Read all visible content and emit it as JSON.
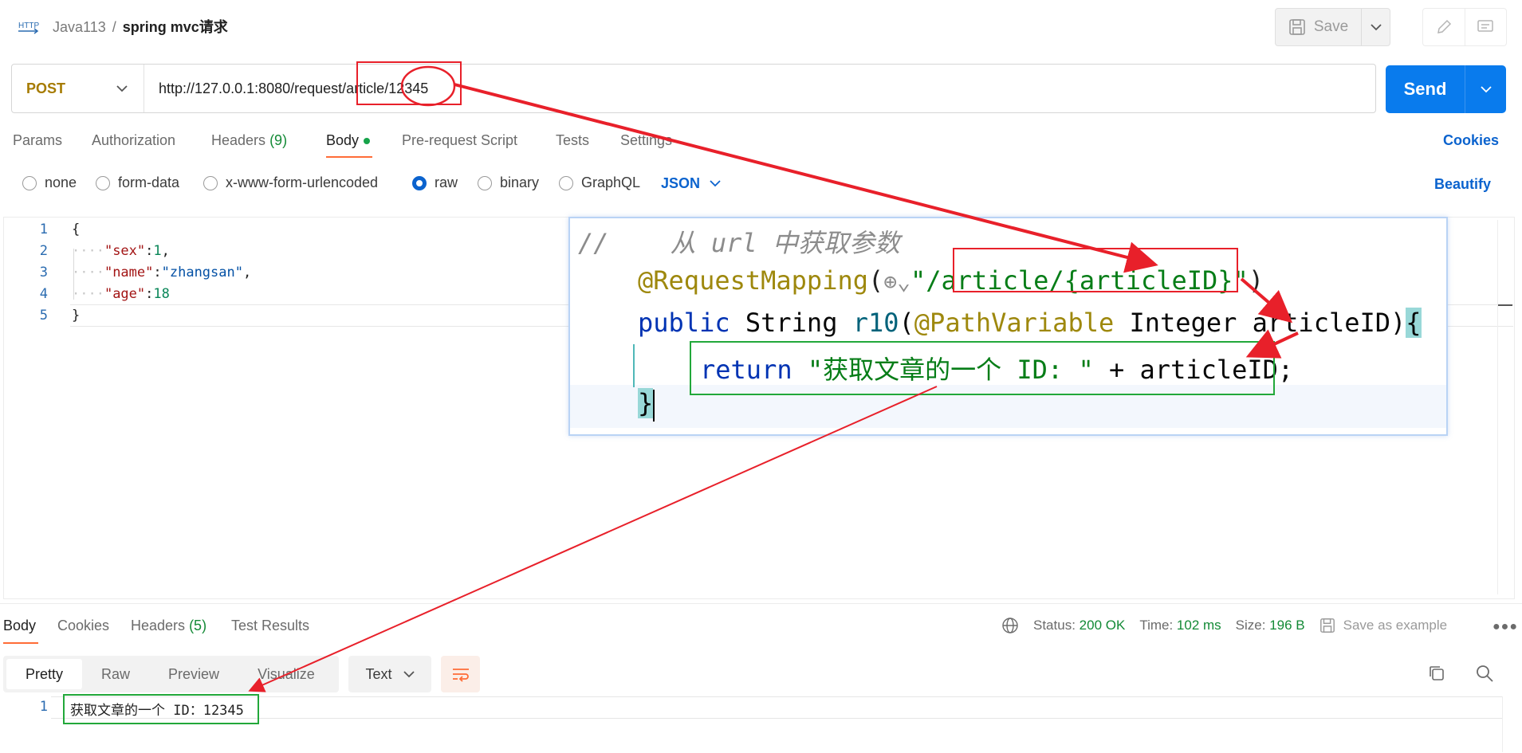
{
  "header": {
    "workspace": "Java113",
    "separator": "/",
    "request_name": "spring mvc请求",
    "http_icon_text": "HTTP",
    "save_label": "Save"
  },
  "request": {
    "method": "POST",
    "url": "http://127.0.0.1:8080/request/article/12345",
    "send_label": "Send"
  },
  "tabs": {
    "params": "Params",
    "authorization": "Authorization",
    "headers": "Headers",
    "headers_count": "(9)",
    "body": "Body",
    "prerequest": "Pre-request Script",
    "tests": "Tests",
    "settings": "Settings",
    "cookies": "Cookies"
  },
  "body_modes": {
    "none": "none",
    "form_data": "form-data",
    "urlencoded": "x-www-form-urlencoded",
    "raw": "raw",
    "binary": "binary",
    "graphql": "GraphQL",
    "format": "JSON",
    "beautify": "Beautify",
    "selected": "raw"
  },
  "editor": {
    "line_numbers": [
      "1",
      "2",
      "3",
      "4",
      "5"
    ],
    "lines": {
      "open": "{",
      "l2_key": "\"sex\"",
      "l2_colon": ":",
      "l2_val": "1",
      "l2_comma": ",",
      "l3_key": "\"name\"",
      "l3_colon": ":",
      "l3_val": "\"zhangsan\"",
      "l3_comma": ",",
      "l4_key": "\"age\"",
      "l4_colon": ":",
      "l4_val": "18",
      "close": "}"
    }
  },
  "overlay_code": {
    "comment_slashes": "//",
    "comment_text": "从 url 中获取参数",
    "annotation": "@RequestMapping",
    "open_paren": "(",
    "globe": "⊕⌄",
    "quote_open": "\"",
    "path": "/article/{articleID}",
    "quote_close": "\"",
    "close_paren": ")",
    "sig_public": "public",
    "sig_type": "String",
    "sig_method": "r10",
    "sig_paren": "(",
    "sig_anno": "@PathVariable",
    "sig_param": "Integer articleID)",
    "sig_brace": "{",
    "ret_kw": "return",
    "ret_str": "\"获取文章的一个 ID: \"",
    "ret_rest": " + articleID;",
    "close_brace": "}"
  },
  "response": {
    "tabs": {
      "body": "Body",
      "cookies": "Cookies",
      "headers": "Headers",
      "headers_count": "(5)",
      "test_results": "Test Results"
    },
    "status_label": "Status:",
    "status_value": "200 OK",
    "time_label": "Time:",
    "time_value": "102 ms",
    "size_label": "Size:",
    "size_value": "196 B",
    "save_example": "Save as example",
    "view_modes": [
      "Pretty",
      "Raw",
      "Preview",
      "Visualize"
    ],
    "format": "Text",
    "line_number": "1",
    "body_text": "获取文章的一个 ID：12345"
  },
  "colors": {
    "accent_orange": "#ff6c37",
    "send_blue": "#097bed",
    "link_blue": "#0b63ce",
    "annotation_red": "#e8202a",
    "annotation_green": "#22a83a",
    "method_post": "#a67b00",
    "status_green": "#138a36"
  }
}
